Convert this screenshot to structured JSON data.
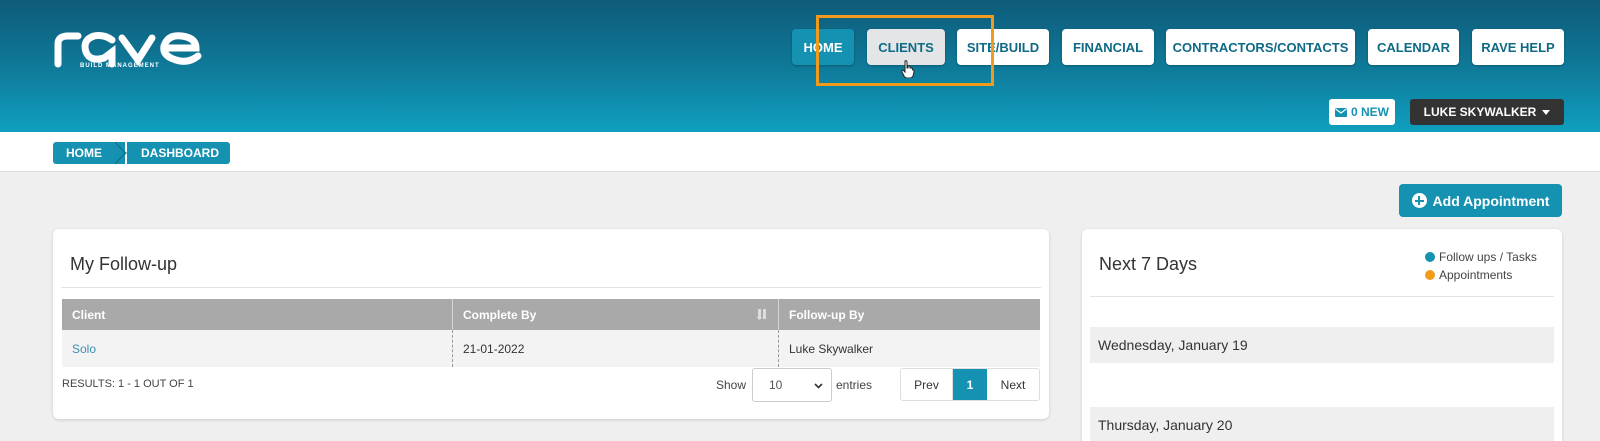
{
  "header": {
    "logo_sub": "BUILD MANAGEMENT",
    "nav": [
      {
        "label": "HOME",
        "state": "active"
      },
      {
        "label": "CLIENTS",
        "state": "hover"
      },
      {
        "label": "SITE/BUILD",
        "state": "normal"
      },
      {
        "label": "FINANCIAL",
        "state": "normal"
      },
      {
        "label": "CONTRACTORS/CONTACTS",
        "state": "normal"
      },
      {
        "label": "CALENDAR",
        "state": "normal"
      },
      {
        "label": "RAVE HELP",
        "state": "normal"
      }
    ],
    "messages_label": "0 NEW",
    "user_label": "LUKE SKYWALKER"
  },
  "breadcrumb": [
    "HOME",
    "DASHBOARD"
  ],
  "add_appointment_label": "Add Appointment",
  "followup": {
    "title": "My Follow-up",
    "columns": [
      "Client",
      "Complete By",
      "Follow-up By"
    ],
    "rows": [
      {
        "client": "Solo",
        "complete_by": "21-01-2022",
        "followup_by": "Luke Skywalker"
      }
    ],
    "results": "RESULTS: 1 - 1 OUT OF 1",
    "show_label": "Show",
    "page_size": "10",
    "entries_label": "entries",
    "prev_label": "Prev",
    "current_page": "1",
    "next_label": "Next"
  },
  "next7": {
    "title": "Next 7 Days",
    "legend": [
      {
        "label": "Follow ups / Tasks",
        "color": "#1592b1"
      },
      {
        "label": "Appointments",
        "color": "#f29b1a"
      }
    ],
    "days": [
      "Wednesday, January 19",
      "Thursday, January 20"
    ]
  },
  "colors": {
    "accent": "#1592b1",
    "highlight": "#f29b1a",
    "header_dark": "#0e5b78"
  },
  "icons": [
    "envelope-icon",
    "caret-down-icon",
    "plus-circle-icon",
    "sort-icon",
    "chevron-down-icon",
    "hand-pointer-icon"
  ]
}
